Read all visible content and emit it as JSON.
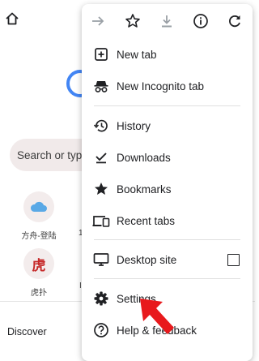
{
  "background": {
    "search_placeholder": "Search or type",
    "tiles": [
      {
        "label": "方舟-登陆",
        "icon": "cloud-icon"
      },
      {
        "label": "虎扑",
        "icon": "hupu-logo",
        "glyph": "虎"
      }
    ],
    "partial_label_1": "1",
    "partial_label_2": "I",
    "discover": "Discover"
  },
  "menu": {
    "toolbar": [
      "forward-icon",
      "bookmark-star-icon",
      "download-icon",
      "info-icon",
      "refresh-icon"
    ],
    "items": [
      {
        "label": "New tab",
        "icon": "new-tab-icon"
      },
      {
        "label": "New Incognito tab",
        "icon": "incognito-icon"
      },
      {
        "label": "History",
        "icon": "history-icon"
      },
      {
        "label": "Downloads",
        "icon": "downloads-icon"
      },
      {
        "label": "Bookmarks",
        "icon": "star-icon"
      },
      {
        "label": "Recent tabs",
        "icon": "recent-tabs-icon"
      },
      {
        "label": "Desktop site",
        "icon": "desktop-icon",
        "checked": false
      },
      {
        "label": "Settings",
        "icon": "settings-icon"
      },
      {
        "label": "Help & feedback",
        "icon": "help-icon"
      }
    ]
  },
  "colors": {
    "arrow": "#e8191c",
    "logo_blue": "#4285f4",
    "hupu_red": "#c62828"
  }
}
